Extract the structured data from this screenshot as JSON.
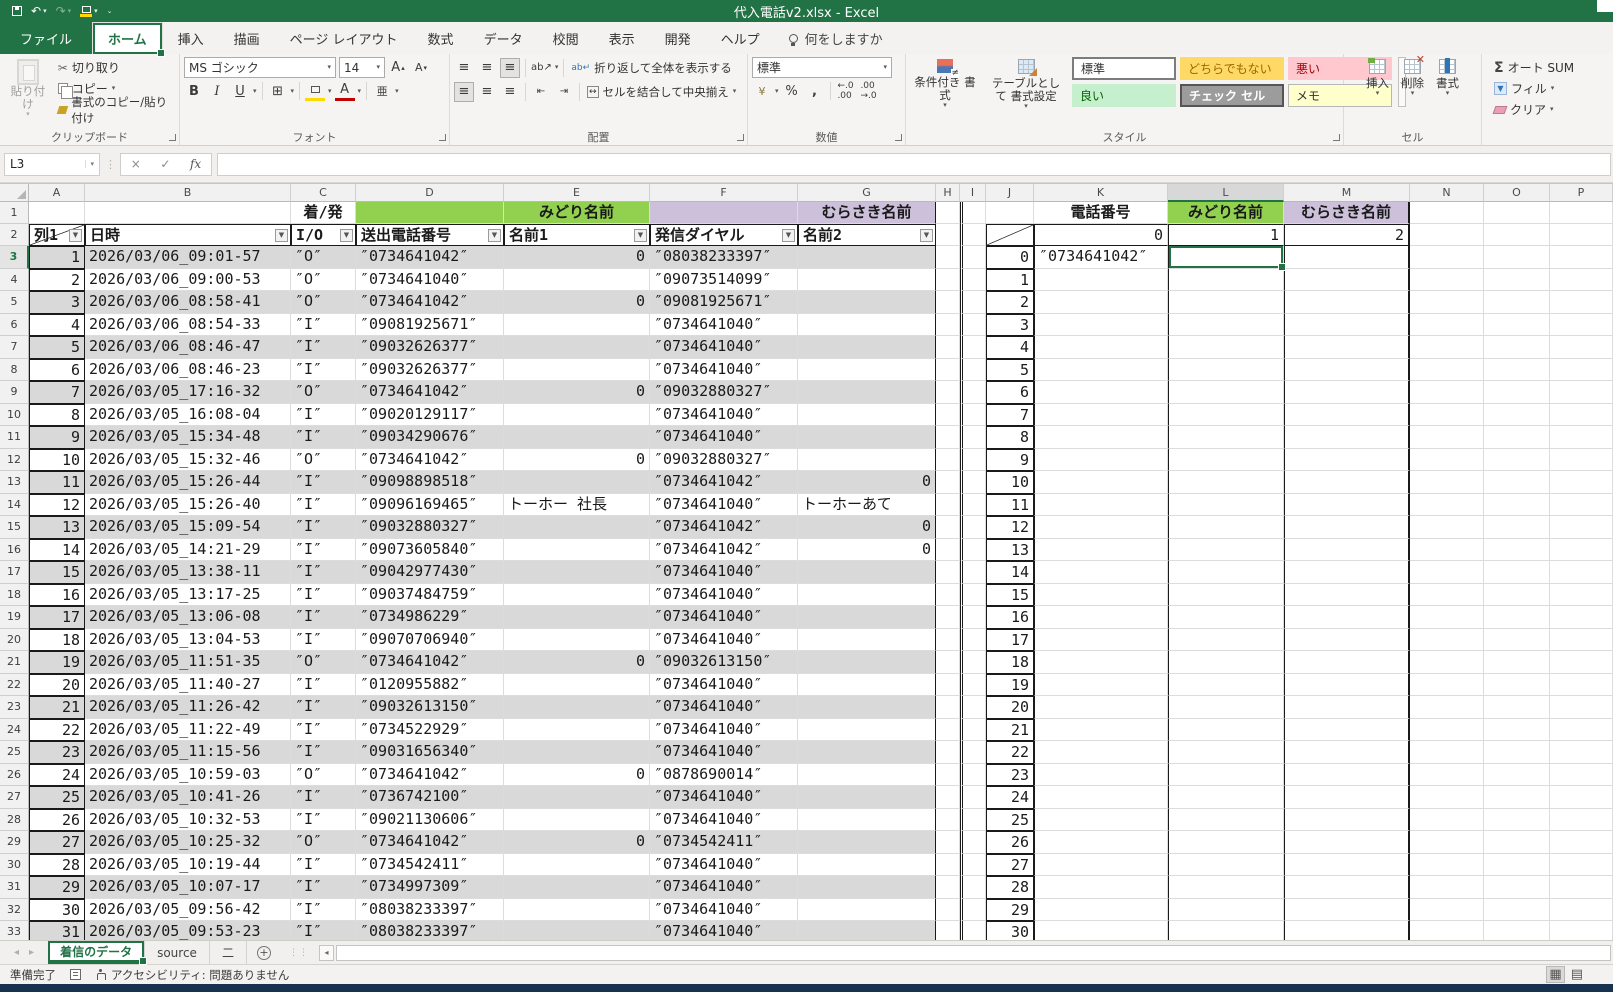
{
  "titlebar": {
    "title": "代入電話v2.xlsx -  Excel"
  },
  "ribbon_tabs": {
    "file": "ファイル",
    "items": [
      "ホーム",
      "挿入",
      "描画",
      "ページ レイアウト",
      "数式",
      "データ",
      "校閲",
      "表示",
      "開発",
      "ヘルプ"
    ],
    "search": "何をしますか"
  },
  "ribbon": {
    "clipboard": {
      "paste": "貼り付け",
      "cut": "切り取り",
      "copy": "コピー",
      "format_painter": "書式のコピー/貼り付け",
      "group": "クリップボード"
    },
    "font": {
      "name": "MS ゴシック",
      "size": "14",
      "bold": "B",
      "italic": "I",
      "underline": "U",
      "phonetic": "亜",
      "group": "フォント"
    },
    "alignment": {
      "wrap": "折り返して全体を表示する",
      "merge": "セルを結合して中央揃え",
      "group": "配置"
    },
    "number": {
      "format": "標準",
      "group": "数値"
    },
    "styles": {
      "conditional": "条件付き 書式",
      "table": "テーブルとして 書式設定",
      "gallery": [
        "標準",
        "どちらでもない",
        "悪い",
        "良い",
        "チェック セル",
        "メモ"
      ],
      "group": "スタイル"
    },
    "cells": {
      "insert": "挿入",
      "remove": "削除",
      "format": "書式",
      "group": "セル"
    },
    "editing": {
      "autosum": "オート SUM",
      "fill": "フィル",
      "clear": "クリア"
    }
  },
  "formula": {
    "name_box": "L3"
  },
  "sheet": {
    "col_letters": [
      "A",
      "B",
      "C",
      "D",
      "E",
      "F",
      "G",
      "H",
      "I",
      "J",
      "K",
      "L",
      "M",
      "N",
      "O",
      "P"
    ],
    "banner": {
      "c": "着/発",
      "green": "みどり名前",
      "purple": "むらさき名前"
    },
    "filter_headers": [
      "列1",
      "日時",
      "I/O",
      "送出電話番号",
      "名前1",
      "発信ダイヤル",
      "名前2"
    ],
    "right": {
      "k1": "電話番号",
      "l1": "みどり名前",
      "m1": "むらさき名前",
      "r2": [
        "0",
        "1",
        "2"
      ],
      "k3": "″0734641042″"
    },
    "rows": [
      [
        "1",
        "2026/03/06_09:01-57",
        "″O″",
        "″0734641042″",
        "0",
        "″08038233397″",
        ""
      ],
      [
        "2",
        "2026/03/06_09:00-53",
        "″O″",
        "″0734641040″",
        "",
        "″09073514099″",
        ""
      ],
      [
        "3",
        "2026/03/06_08:58-41",
        "″O″",
        "″0734641042″",
        "0",
        "″09081925671″",
        ""
      ],
      [
        "4",
        "2026/03/06_08:54-33",
        "″I″",
        "″09081925671″",
        "",
        "″0734641040″",
        ""
      ],
      [
        "5",
        "2026/03/06_08:46-47",
        "″I″",
        "″09032626377″",
        "",
        "″0734641040″",
        ""
      ],
      [
        "6",
        "2026/03/06_08:46-23",
        "″I″",
        "″09032626377″",
        "",
        "″0734641040″",
        ""
      ],
      [
        "7",
        "2026/03/05_17:16-32",
        "″O″",
        "″0734641042″",
        "0",
        "″09032880327″",
        ""
      ],
      [
        "8",
        "2026/03/05_16:08-04",
        "″I″",
        "″09020129117″",
        "",
        "″0734641040″",
        ""
      ],
      [
        "9",
        "2026/03/05_15:34-48",
        "″I″",
        "″09034290676″",
        "",
        "″0734641040″",
        ""
      ],
      [
        "10",
        "2026/03/05_15:32-46",
        "″O″",
        "″0734641042″",
        "0",
        "″09032880327″",
        ""
      ],
      [
        "11",
        "2026/03/05_15:26-44",
        "″I″",
        "″09098898518″",
        "",
        "″0734641042″",
        "0"
      ],
      [
        "12",
        "2026/03/05_15:26-40",
        "″I″",
        "″09096169465″",
        "トーホー 社長",
        "″0734641040″",
        "トーホーあて"
      ],
      [
        "13",
        "2026/03/05_15:09-54",
        "″I″",
        "″09032880327″",
        "",
        "″0734641042″",
        "0"
      ],
      [
        "14",
        "2026/03/05_14:21-29",
        "″I″",
        "″09073605840″",
        "",
        "″0734641042″",
        "0"
      ],
      [
        "15",
        "2026/03/05_13:38-11",
        "″I″",
        "″09042977430″",
        "",
        "″0734641040″",
        ""
      ],
      [
        "16",
        "2026/03/05_13:17-25",
        "″I″",
        "″09037484759″",
        "",
        "″0734641040″",
        ""
      ],
      [
        "17",
        "2026/03/05_13:06-08",
        "″I″",
        "″0734986229″",
        "",
        "″0734641040″",
        ""
      ],
      [
        "18",
        "2026/03/05_13:04-53",
        "″I″",
        "″09070706940″",
        "",
        "″0734641040″",
        ""
      ],
      [
        "19",
        "2026/03/05_11:51-35",
        "″O″",
        "″0734641042″",
        "0",
        "″09032613150″",
        ""
      ],
      [
        "20",
        "2026/03/05_11:40-27",
        "″I″",
        "″0120955882″",
        "",
        "″0734641040″",
        ""
      ],
      [
        "21",
        "2026/03/05_11:26-42",
        "″I″",
        "″09032613150″",
        "",
        "″0734641040″",
        ""
      ],
      [
        "22",
        "2026/03/05_11:22-49",
        "″I″",
        "″0734522929″",
        "",
        "″0734641040″",
        ""
      ],
      [
        "23",
        "2026/03/05_11:15-56",
        "″I″",
        "″09031656340″",
        "",
        "″0734641040″",
        ""
      ],
      [
        "24",
        "2026/03/05_10:59-03",
        "″O″",
        "″0734641042″",
        "0",
        "″0878690014″",
        ""
      ],
      [
        "25",
        "2026/03/05_10:41-26",
        "″I″",
        "″0736742100″",
        "",
        "″0734641040″",
        ""
      ],
      [
        "26",
        "2026/03/05_10:32-53",
        "″I″",
        "″09021130606″",
        "",
        "″0734641040″",
        ""
      ],
      [
        "27",
        "2026/03/05_10:25-32",
        "″O″",
        "″0734641042″",
        "0",
        "″0734542411″",
        ""
      ],
      [
        "28",
        "2026/03/05_10:19-44",
        "″I″",
        "″0734542411″",
        "",
        "″0734641040″",
        ""
      ],
      [
        "29",
        "2026/03/05_10:07-17",
        "″I″",
        "″0734997309″",
        "",
        "″0734641040″",
        ""
      ],
      [
        "30",
        "2026/03/05_09:56-42",
        "″I″",
        "″08038233397″",
        "",
        "″0734641040″",
        ""
      ],
      [
        "31",
        "2026/03/05_09:53-23",
        "″I″",
        "″08038233397″",
        "",
        "″0734641040″",
        ""
      ]
    ]
  },
  "sheet_tabs": {
    "tabs": [
      "着信のデータ",
      "source",
      "二"
    ],
    "active": 0
  },
  "status": {
    "ready": "準備完了",
    "accessibility": "アクセシビリティ: 問題ありません"
  },
  "colors": {
    "excel_green": "#217346",
    "banner_green": "#92D050",
    "banner_purple": "#CCC0DA",
    "band_gray": "#D9D9D9",
    "neutral_bg": "#FFD966",
    "neutral_text": "#9C6500",
    "bad_bg": "#FFC7CE",
    "bad_text": "#9C0006",
    "good_bg": "#C6EFCE",
    "good_text": "#006100",
    "note_bg": "#FFFFCC",
    "navy_strip": "#16324F"
  }
}
